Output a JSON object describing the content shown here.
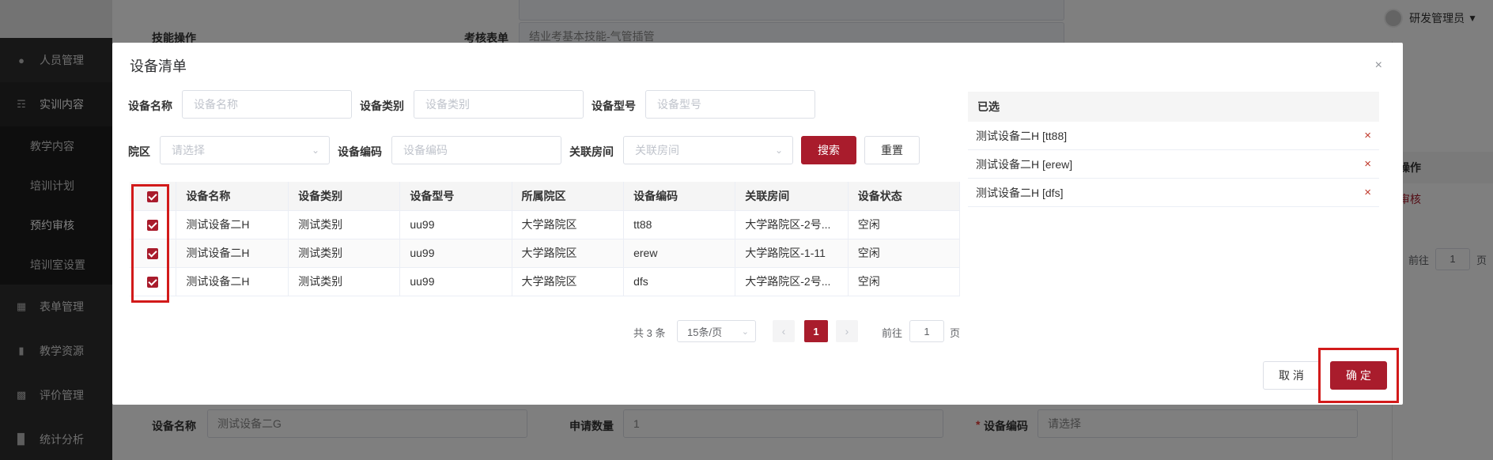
{
  "user": {
    "name": "研发管理员"
  },
  "sidebar": {
    "items": [
      {
        "label": "人员管理",
        "icon": "users-icon"
      },
      {
        "label": "实训内容",
        "icon": "content-icon"
      },
      {
        "label": "表单管理",
        "icon": "form-icon"
      },
      {
        "label": "教学资源",
        "icon": "resource-icon"
      },
      {
        "label": "评价管理",
        "icon": "evaluate-icon"
      },
      {
        "label": "统计分析",
        "icon": "chart-icon"
      }
    ],
    "subitems": [
      "教学内容",
      "培训计划",
      "预约审核",
      "培训室设置"
    ]
  },
  "background": {
    "skill_label": "技能操作",
    "exam_label": "考核表单",
    "exam_value": "结业考基本技能-气管插管",
    "right_col_header": "操作",
    "right_col_link": "审核",
    "right_goto": "前往",
    "right_page": "1",
    "right_page_unit": "页",
    "device_name_label": "设备名称",
    "device_name_value": "测试设备二G",
    "apply_qty_label": "申请数量",
    "apply_qty_value": "1",
    "device_code_label": "设备编码",
    "device_code_placeholder": "请选择",
    "required_mark": "*"
  },
  "dialog": {
    "title": "设备清单",
    "close": "×",
    "filters": {
      "name_label": "设备名称",
      "name_placeholder": "设备名称",
      "type_label": "设备类别",
      "type_placeholder": "设备类别",
      "model_label": "设备型号",
      "model_placeholder": "设备型号",
      "campus_label": "院区",
      "campus_placeholder": "请选择",
      "code_label": "设备编码",
      "code_placeholder": "设备编码",
      "room_label": "关联房间",
      "room_placeholder": "关联房间",
      "search": "搜索",
      "reset": "重置"
    },
    "table": {
      "headers": [
        "设备名称",
        "设备类别",
        "设备型号",
        "所属院区",
        "设备编码",
        "关联房间",
        "设备状态"
      ],
      "rows": [
        [
          "测试设备二H",
          "测试类别",
          "uu99",
          "大学路院区",
          "tt88",
          "大学路院区-2号...",
          "空闲"
        ],
        [
          "测试设备二H",
          "测试类别",
          "uu99",
          "大学路院区",
          "erew",
          "大学路院区-1-11",
          "空闲"
        ],
        [
          "测试设备二H",
          "测试类别",
          "uu99",
          "大学路院区",
          "dfs",
          "大学路院区-2号...",
          "空闲"
        ]
      ]
    },
    "pagination": {
      "total": "共 3 条",
      "page_size": "15条/页",
      "current": "1",
      "goto_label": "前往",
      "goto_value": "1",
      "page_unit": "页"
    },
    "selected": {
      "header": "已选",
      "items": [
        "测试设备二H [tt88]",
        "测试设备二H [erew]",
        "测试设备二H [dfs]"
      ],
      "remove": "×"
    },
    "footer": {
      "cancel": "取 消",
      "confirm": "确 定"
    }
  },
  "colors": {
    "accent": "#a91c2c",
    "highlight": "#d21a1a",
    "sidebar": "#2f2f2f"
  }
}
